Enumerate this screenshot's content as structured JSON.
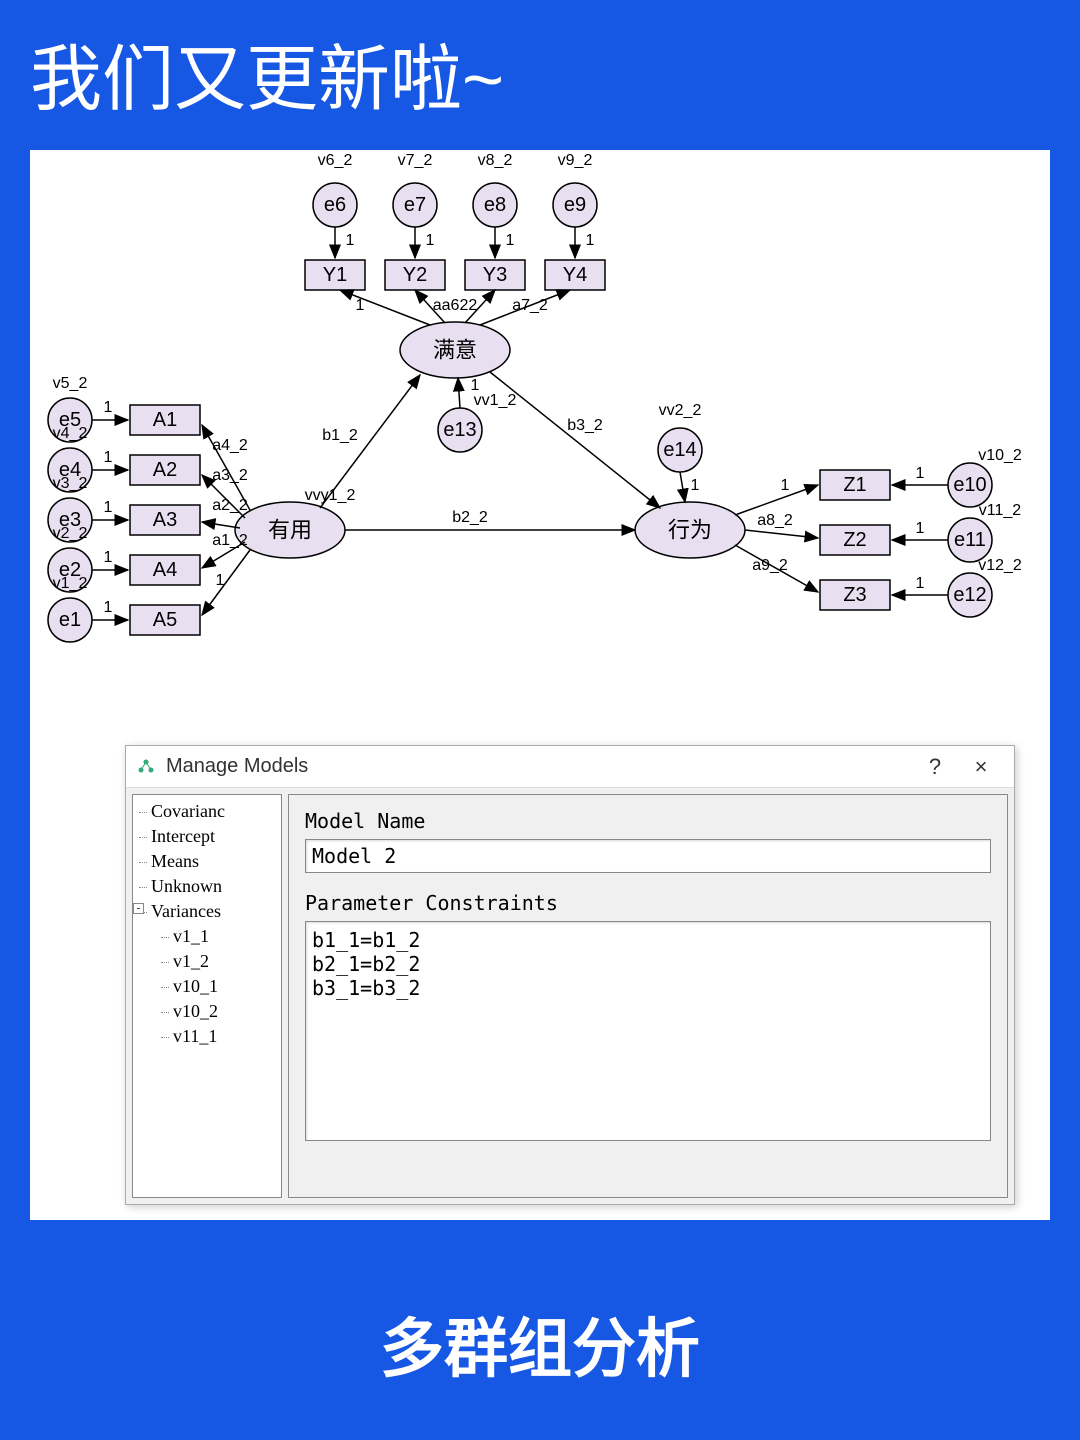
{
  "header": {
    "title": "我们又更新啦~"
  },
  "footer": {
    "title": "多群组分析"
  },
  "diagram": {
    "latent": {
      "useful": "有用",
      "satisfy": "满意",
      "behavior": "行为"
    },
    "observed": {
      "A": [
        "A1",
        "A2",
        "A3",
        "A4",
        "A5"
      ],
      "Y": [
        "Y1",
        "Y2",
        "Y3",
        "Y4"
      ],
      "Z": [
        "Z1",
        "Z2",
        "Z3"
      ]
    },
    "errors": {
      "eA": [
        "e5",
        "e4",
        "e3",
        "e2",
        "e1"
      ],
      "eY": [
        "e6",
        "e7",
        "e8",
        "e9"
      ],
      "eZ": [
        "e10",
        "e11",
        "e12"
      ],
      "eLatent": [
        "e13",
        "e14"
      ]
    },
    "var_labels": {
      "vA": [
        "v5_2",
        "v4_2",
        "v3_2",
        "v2_2",
        "v1_2"
      ],
      "vY": [
        "v6_2",
        "v7_2",
        "v8_2",
        "v9_2"
      ],
      "vZ": [
        "v10_2",
        "v11_2",
        "v12_2"
      ],
      "vv": [
        "vv1_2",
        "vv2_2",
        "vvy1_2"
      ]
    },
    "path_labels": {
      "a": [
        "a4_2",
        "a3_2",
        "a2_2",
        "a1_2"
      ],
      "aY": [
        "aa622",
        "a7_2"
      ],
      "aZ": [
        "a8_2",
        "a9_2"
      ],
      "b": [
        "b1_2",
        "b2_2",
        "b3_2"
      ]
    },
    "one": "1"
  },
  "dialog": {
    "title": "Manage Models",
    "help": "?",
    "close": "×",
    "tree": {
      "root_items": [
        "Covarianc",
        "Intercept",
        "Means",
        "Unknown",
        "Variances"
      ],
      "variance_children": [
        "v1_1",
        "v1_2",
        "v10_1",
        "v10_2",
        "v11_1"
      ]
    },
    "form": {
      "model_name_label": "Model Name",
      "model_name_value": "Model 2",
      "constraints_label": "Parameter Constraints",
      "constraints_value": "b1_1=b1_2\nb2_1=b2_2\nb3_1=b3_2"
    }
  }
}
